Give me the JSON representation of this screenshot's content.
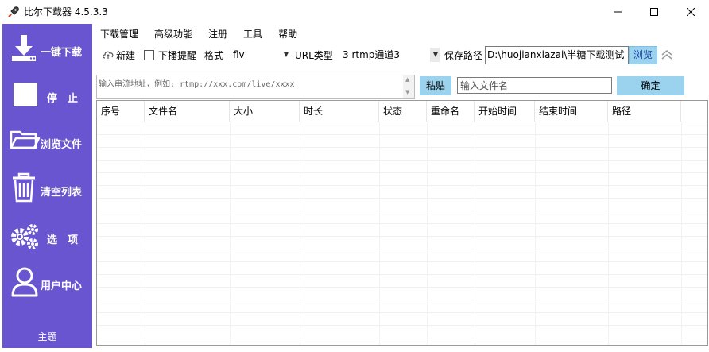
{
  "window": {
    "title": "比尔下载器 4.5.3.3"
  },
  "sidebar": {
    "bg_color": "#6a55d0",
    "items": [
      {
        "label": "一键下载",
        "icon": "download-icon"
      },
      {
        "label": "停　止",
        "icon": "stop-icon"
      },
      {
        "label": "浏览文件",
        "icon": "folder-icon"
      },
      {
        "label": "清空列表",
        "icon": "trash-icon"
      },
      {
        "label": "选　项",
        "icon": "gears-icon"
      },
      {
        "label": "用户中心",
        "icon": "user-icon"
      }
    ],
    "theme_label": "主题"
  },
  "menu": {
    "items": [
      "下载管理",
      "高级功能",
      "注册",
      "工具",
      "帮助"
    ]
  },
  "toolbar": {
    "new_label": "新建",
    "download_alert_label": "下播提醒",
    "download_alert_checked": false,
    "format_label": "格式",
    "format_value": "flv",
    "url_type_label": "URL类型",
    "url_type_value": "3 rtmp通道3",
    "save_path_label": "保存路径",
    "save_path_value": "D:\\huojianxiazai\\半糖下载测试",
    "browse_label": "浏览"
  },
  "input_row": {
    "url_placeholder": "输入串流地址，例如: rtmp://xxx.com/live/xxxx",
    "paste_label": "粘贴",
    "filename_placeholder": "输入文件名",
    "confirm_label": "确定"
  },
  "table": {
    "columns": [
      "序号",
      "文件名",
      "大小",
      "时长",
      "状态",
      "重命名",
      "开始时间",
      "结束时间",
      "路径"
    ],
    "rows": []
  },
  "colors": {
    "accent_button": "#9bd3ee",
    "sidebar": "#6a55d0"
  }
}
